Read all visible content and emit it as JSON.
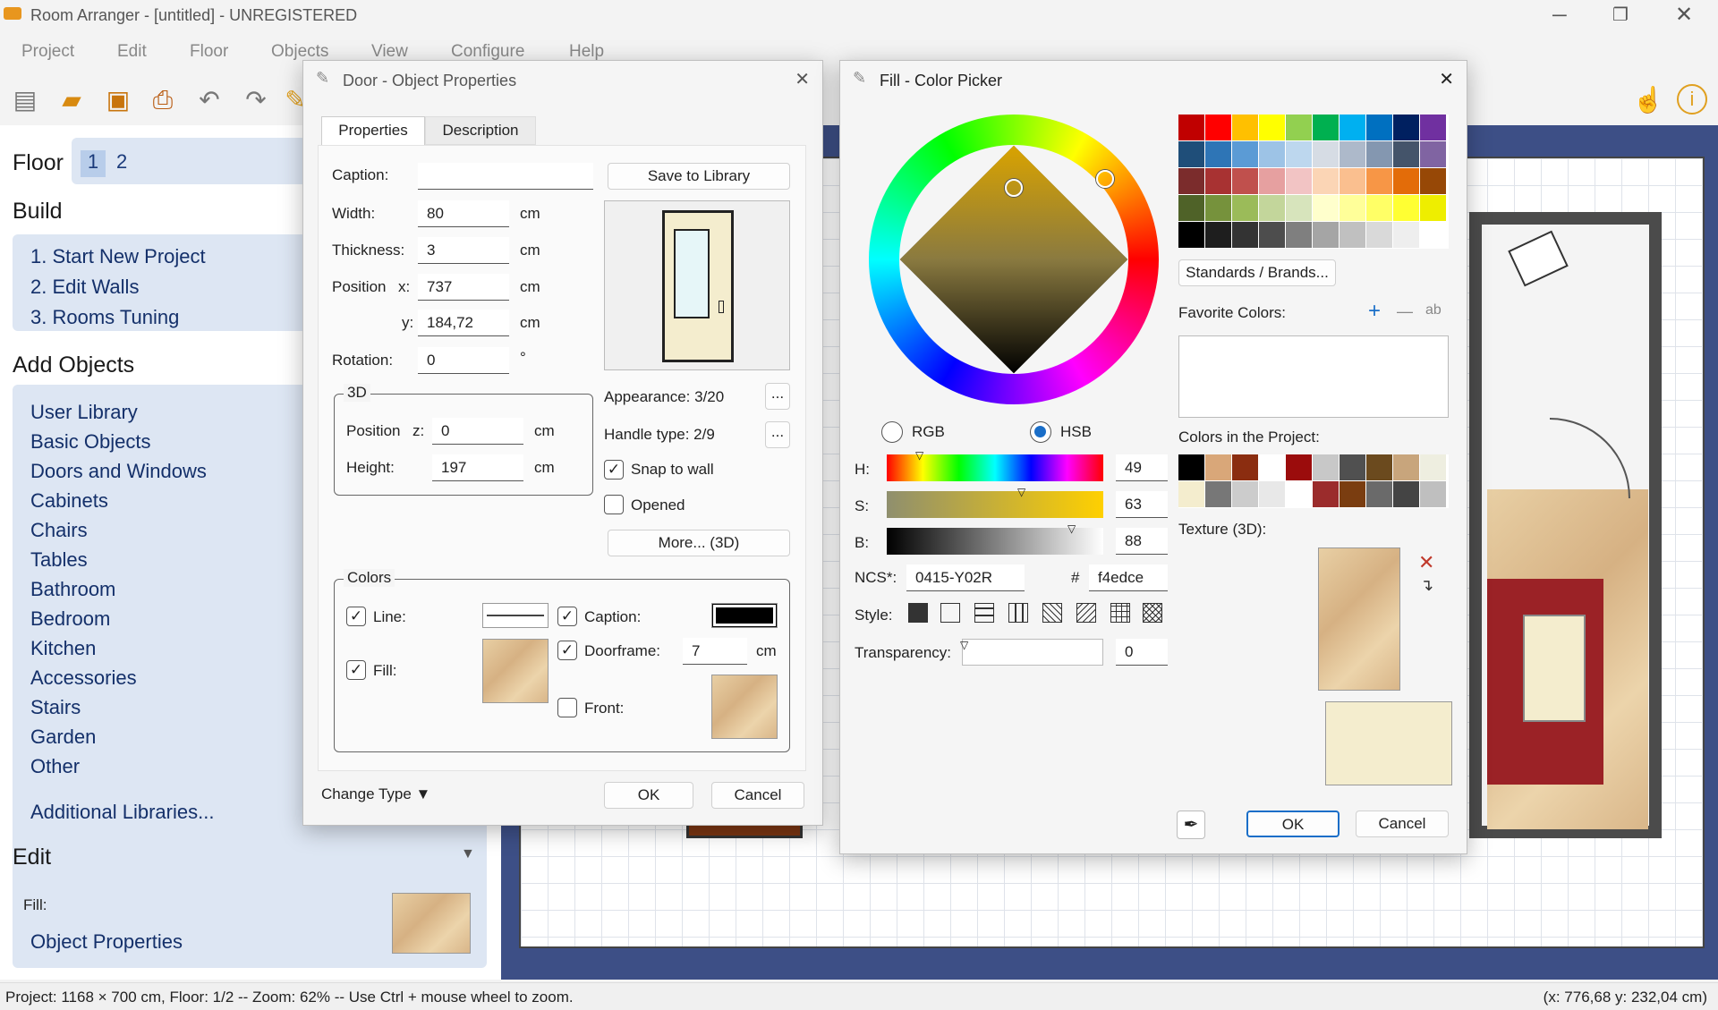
{
  "app": {
    "title": "Room Arranger - [untitled] - UNREGISTERED",
    "icon": "sofa-icon"
  },
  "menu": [
    "Project",
    "Edit",
    "Floor",
    "Objects",
    "View",
    "Configure",
    "Help"
  ],
  "toolbar": [
    "new-project-icon",
    "open-folder-icon",
    "save-icon",
    "print-icon",
    "undo-icon",
    "redo-icon",
    "pencil-icon"
  ],
  "left": {
    "floor_label": "Floor",
    "floors": [
      "1",
      "2"
    ],
    "build_label": "Build",
    "build_items": [
      "1. Start New Project",
      "2. Edit Walls",
      "3. Rooms Tuning"
    ],
    "add_label": "Add Objects",
    "objects": [
      "User Library",
      "Basic Objects",
      "Doors and Windows",
      "Cabinets",
      "Chairs",
      "Tables",
      "Bathroom",
      "Bedroom",
      "Kitchen",
      "Accessories",
      "Stairs",
      "Garden",
      "Other"
    ],
    "additional": "Additional Libraries...",
    "edit_label": "Edit",
    "fill_label": "Fill:",
    "object_props": "Object Properties"
  },
  "status": {
    "left": "Project: 1168 × 700 cm, Floor: 1/2 -- Zoom: 62% -- Use Ctrl + mouse wheel to zoom.",
    "right": "(x: 776,68 y: 232,04 cm)"
  },
  "door": {
    "title": "Door - Object Properties",
    "tabs": [
      "Properties",
      "Description"
    ],
    "caption_label": "Caption:",
    "caption_value": "",
    "save_library": "Save to Library",
    "width_label": "Width:",
    "width": "80",
    "unit": "cm",
    "thickness_label": "Thickness:",
    "thickness": "3",
    "position_label": "Position",
    "x_label": "x:",
    "x": "737",
    "y_label": "y:",
    "y": "184,72",
    "rotation_label": "Rotation:",
    "rotation": "0",
    "deg": "°",
    "group3d": "3D",
    "posz_label": "Position",
    "z_label": "z:",
    "z": "0",
    "height_label": "Height:",
    "height": "197",
    "appearance": "Appearance: 3/20",
    "handle": "Handle type: 2/9",
    "dots": "...",
    "snap": "Snap to wall",
    "opened": "Opened",
    "more3d": "More... (3D)",
    "colors": "Colors",
    "line": "Line:",
    "caption2": "Caption:",
    "fill": "Fill:",
    "doorframe": "Doorframe:",
    "doorframe_val": "7",
    "front": "Front:",
    "change_type": "Change Type ▼",
    "ok": "OK",
    "cancel": "Cancel"
  },
  "picker": {
    "title": "Fill - Color Picker",
    "rgb": "RGB",
    "hsb": "HSB",
    "h_label": "H:",
    "h": "49",
    "s_label": "S:",
    "s": "63",
    "b_label": "B:",
    "b": "88",
    "ncs_label": "NCS*:",
    "ncs": "0415-Y02R",
    "hash": "#",
    "hex": "f4edce",
    "style_label": "Style:",
    "transparency_label": "Transparency:",
    "transparency": "0",
    "standards": "Standards / Brands...",
    "favorites": "Favorite Colors:",
    "fav_add": "+",
    "fav_remove": "—",
    "fav_ab": "ab",
    "project_colors_label": "Colors in the Project:",
    "texture_label": "Texture (3D):",
    "ok": "OK",
    "cancel": "Cancel",
    "palette": [
      "#c00000",
      "#ff0000",
      "#ffc000",
      "#ffff00",
      "#92d050",
      "#00b050",
      "#00b0f0",
      "#0070c0",
      "#002060",
      "#7030a0",
      "#1f4e79",
      "#2e75b6",
      "#5b9bd5",
      "#9dc3e6",
      "#bdd7ee",
      "#d6dce4",
      "#adb9ca",
      "#8497b0",
      "#44546a",
      "#8064a2",
      "#7b2c2c",
      "#a83232",
      "#c0504d",
      "#e6a0a0",
      "#f2c4c4",
      "#fbd5b5",
      "#fabf8f",
      "#f79646",
      "#e36c09",
      "#974806",
      "#4f6228",
      "#76923c",
      "#9bbb59",
      "#c3d69b",
      "#d7e4bc",
      "#ffffcc",
      "#ffff99",
      "#ffff66",
      "#ffff33",
      "#eeee00",
      "#000000",
      "#1e1e1e",
      "#333333",
      "#4d4d4d",
      "#7f7f7f",
      "#a5a5a5",
      "#c0c0c0",
      "#d9d9d9",
      "#eeeeee",
      "#ffffff"
    ],
    "project_colors": [
      "#000000",
      "#d9a779",
      "#8b2d10",
      "#ffffff",
      "#9b0c0c",
      "#c8c8c8",
      "#505050",
      "#6b4a1e",
      "#c8a57c",
      "#eeeee0",
      "#f4edce",
      "#777777",
      "#cccccc",
      "#e8e8e8",
      "#ffffff",
      "#9b2c2c",
      "#7a3d10",
      "#6a6a6a",
      "#444444",
      "#bfbfbf"
    ]
  }
}
